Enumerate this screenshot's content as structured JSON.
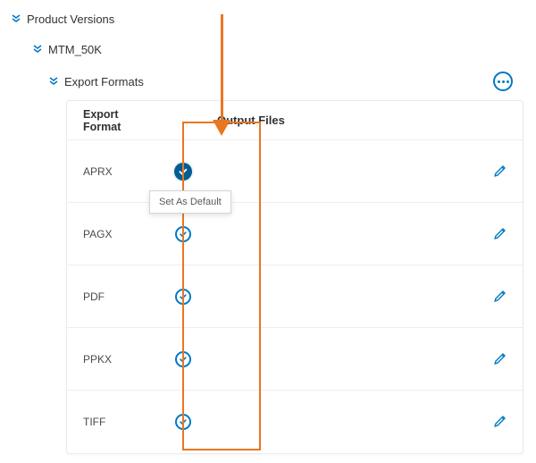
{
  "colors": {
    "accent": "#0079c1",
    "accent_dark": "#005e95",
    "annotation": "#e87722"
  },
  "tree": {
    "root_label": "Product Versions",
    "child_label": "MTM_50K",
    "grandchild_label": "Export Formats"
  },
  "table": {
    "header_format": "Export Format",
    "header_output": "Output Files",
    "rows": [
      {
        "format": "APRX",
        "is_default": true
      },
      {
        "format": "PAGX",
        "is_default": false
      },
      {
        "format": "PDF",
        "is_default": false
      },
      {
        "format": "PPKX",
        "is_default": false
      },
      {
        "format": "TIFF",
        "is_default": false
      }
    ]
  },
  "tooltip": {
    "set_as_default": "Set As Default"
  },
  "icons": {
    "chevrons": "double-chevron-down-icon",
    "overflow": "ellipsis-icon",
    "status_default": "check-filled-icon",
    "status_available": "check-outline-icon",
    "edit": "pencil-icon"
  }
}
